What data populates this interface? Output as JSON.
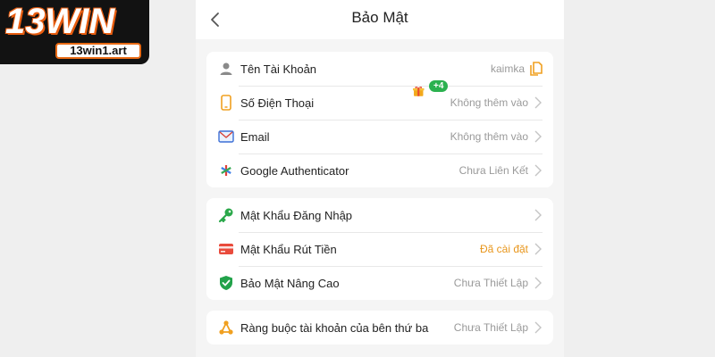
{
  "logo": {
    "text": "13WIN",
    "url": "13win1.art"
  },
  "header": {
    "title": "Bảo Mật"
  },
  "cards": [
    {
      "rows": [
        {
          "label": "Tên Tài Khoản",
          "value": "kaimka",
          "icon": "user-icon",
          "trailing": "copy-icon"
        },
        {
          "label": "Số Điện Thoại",
          "value": "Không thêm vào",
          "icon": "phone-icon",
          "trailing": "chevron-right-icon"
        },
        {
          "label": "Email",
          "value": "Không thêm vào",
          "icon": "email-icon",
          "trailing": "chevron-right-icon"
        },
        {
          "label": "Google Authenticator",
          "value": "Chưa Liên Kết",
          "icon": "google-authenticator-icon",
          "trailing": "chevron-right-icon"
        }
      ]
    },
    {
      "rows": [
        {
          "label": "Mật Khẩu Đăng Nhập",
          "value": "",
          "icon": "key-icon",
          "trailing": "chevron-right-icon"
        },
        {
          "label": "Mật Khẩu Rút Tiền",
          "value": "Đã cài đặt",
          "value_color": "#e8961c",
          "icon": "credit-card-icon",
          "trailing": "chevron-right-icon"
        },
        {
          "label": "Bảo Mật Nâng Cao",
          "value": "Chưa Thiết Lập",
          "icon": "shield-check-icon",
          "trailing": "chevron-right-icon"
        }
      ]
    },
    {
      "rows": [
        {
          "label": "Ràng buộc tài khoản của bên thứ ba",
          "value": "Chưa Thiết Lập",
          "icon": "link-nodes-icon",
          "trailing": "chevron-right-icon"
        }
      ]
    }
  ],
  "gift": {
    "badge": "+4",
    "icon": "gift-icon"
  },
  "colors": {
    "accent": "#e8961c",
    "badge": "#2bb14f",
    "logo_bg": "#121212",
    "logo_outline": "#e85d10"
  }
}
